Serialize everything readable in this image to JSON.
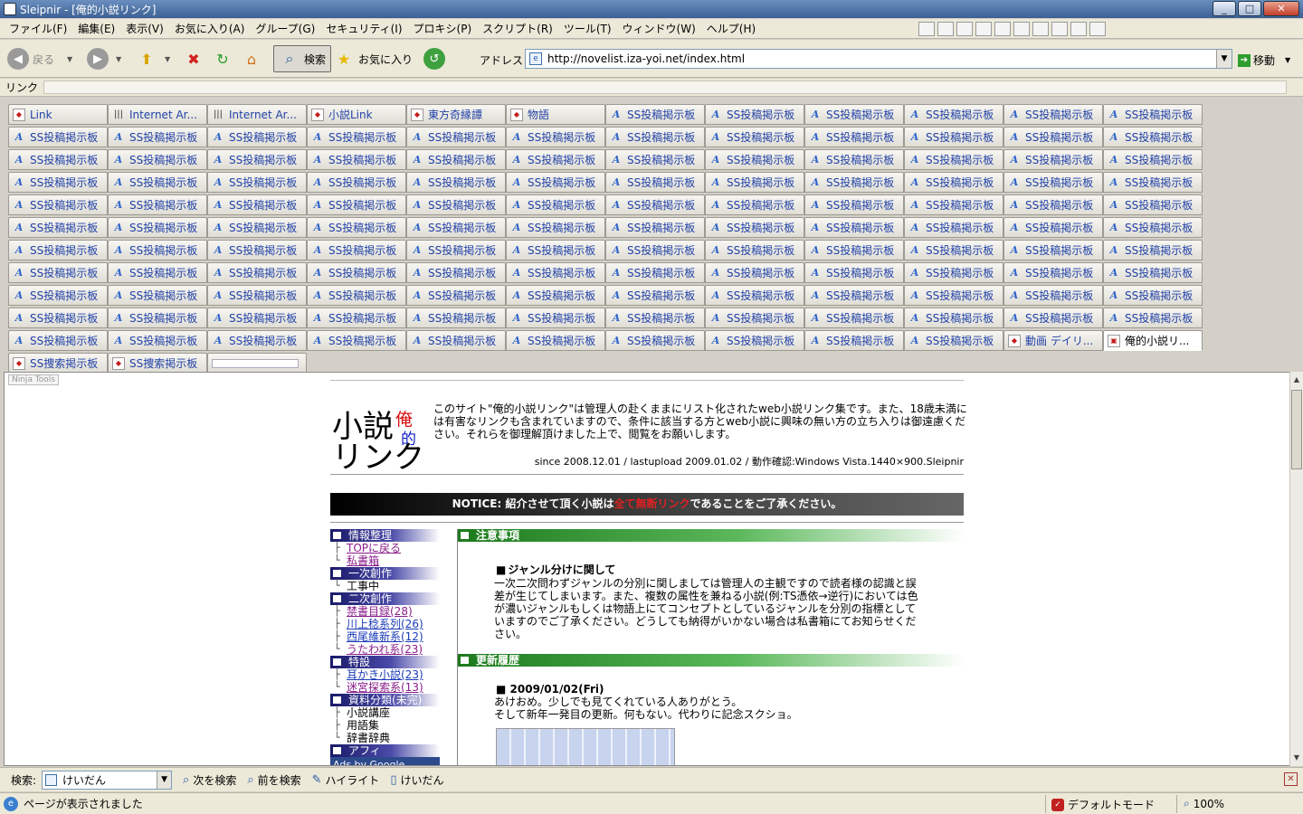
{
  "window": {
    "title": "Sleipnir - [俺的小説リンク]",
    "min": "_",
    "max": "□",
    "close": "✕"
  },
  "menu": [
    "ファイル(F)",
    "編集(E)",
    "表示(V)",
    "お気に入り(A)",
    "グループ(G)",
    "セキュリティ(I)",
    "プロキシ(P)",
    "スクリプト(R)",
    "ツール(T)",
    "ウィンドウ(W)",
    "ヘルプ(H)"
  ],
  "toolbar": {
    "back": "戻る",
    "search": "検索",
    "favorites": "お気に入り",
    "address_label": "アドレス",
    "go": "移動"
  },
  "address": {
    "url": "http://novelist.iza-yoi.net/index.html"
  },
  "links_bar": {
    "label": "リンク"
  },
  "tabs": [
    {
      "label": "Link",
      "icon": "r"
    },
    {
      "label": "Internet Ar...",
      "icon": "b"
    },
    {
      "label": "Internet Ar...",
      "icon": "b"
    },
    {
      "label": "小説Link",
      "icon": "r"
    },
    {
      "label": "東方奇縁譚",
      "icon": "r"
    },
    {
      "label": "物語",
      "icon": "r"
    },
    {
      "label": "SS投稿掲示板",
      "icon": "a"
    },
    {
      "label": "SS投稿掲示板",
      "icon": "a"
    },
    {
      "label": "SS投稿掲示板",
      "icon": "a"
    },
    {
      "label": "SS投稿掲示板",
      "icon": "a"
    },
    {
      "label": "SS投稿掲示板",
      "icon": "a"
    },
    {
      "label": "SS投稿掲示板",
      "icon": "a"
    }
  ],
  "tabs_repeat_label": "SS投稿掲示板",
  "tabs_tail": [
    {
      "label": "動画 デイリ...",
      "icon": "r"
    },
    {
      "label": "俺的小説リ...",
      "icon": "p",
      "active": true
    }
  ],
  "tabs_last_row": [
    {
      "label": "SS捜索掲示板",
      "icon": "r"
    },
    {
      "label": "SS捜索掲示板",
      "icon": "r"
    }
  ],
  "ninja": "Ninja Tools",
  "site": {
    "logo_a": "小説",
    "logo_b": "リンク",
    "logo_ore": "俺",
    "logo_teki": "的",
    "intro": "このサイト\"俺的小説リンク\"は管理人の赴くままにリスト化されたweb小説リンク集です。また、18歳未満には有害なリンクも含まれていますので、条件に該当する方とweb小説に興味の無い方の立ち入りは御遠慮ください。それらを御理解頂けました上で、閲覧をお願いします。",
    "since": "since 2008.12.01 / lastupload 2009.01.02 / 動作確認:Windows Vista.1440×900.Sleipnir",
    "notice_a": "NOTICE: 紹介させて頂く小説は",
    "notice_red": "全て無断リンク",
    "notice_b": "であることをご了承ください。"
  },
  "sidebar": [
    {
      "type": "h",
      "label": "情報整理"
    },
    {
      "type": "i",
      "label": "TOPに戻る",
      "link": "p"
    },
    {
      "type": "i",
      "label": "私書箱",
      "link": "p"
    },
    {
      "type": "h",
      "label": "一次創作"
    },
    {
      "type": "i",
      "label": "工事中",
      "link": ""
    },
    {
      "type": "h",
      "label": "二次創作"
    },
    {
      "type": "i",
      "label": "禁書目録(28)",
      "link": "p"
    },
    {
      "type": "i",
      "label": "川上稔系列(26)",
      "link": "b"
    },
    {
      "type": "i",
      "label": "西尾維新系(12)",
      "link": "b"
    },
    {
      "type": "i",
      "label": "うたわれ系(23)",
      "link": "p"
    },
    {
      "type": "h",
      "label": "特設"
    },
    {
      "type": "i",
      "label": "耳かき小説(23)",
      "link": "b"
    },
    {
      "type": "i",
      "label": "迷宮探索系(13)",
      "link": "p"
    },
    {
      "type": "h",
      "label": "資料分類(未完)"
    },
    {
      "type": "i",
      "label": "小説講座",
      "link": ""
    },
    {
      "type": "i",
      "label": "用語集",
      "link": ""
    },
    {
      "type": "i",
      "label": "辞書辞典",
      "link": ""
    },
    {
      "type": "h",
      "label": "アフィ"
    }
  ],
  "ads": "Ads by Google",
  "main": {
    "h1": "注意事項",
    "p_title": "ジャンル分けに関して",
    "p_text": "一次二次問わずジャンルの分別に関しましては管理人の主観ですので読者様の認識と誤差が生じてしまいます。また、複数の属性を兼ねる小説(例:TS憑依→逆行)においては色が濃いジャンルもしくは物語上にてコンセプトとしているジャンルを分別の指標としていますのでご了承ください。どうしても納得がいかない場合は私書箱にてお知らせください。",
    "h2": "更新履歴",
    "d_title": "2009/01/02(Fri)",
    "d_text1": "あけおめ。少しでも見てくれている人ありがとう。",
    "d_text2": "そして新年一発目の更新。何もない。代わりに記念スクショ。"
  },
  "findbar": {
    "label": "検索:",
    "value": "けいだん",
    "next": "次を検索",
    "prev": "前を検索",
    "highlight": "ハイライト",
    "word": "けいだん"
  },
  "status": {
    "text": "ページが表示されました",
    "mode": "デフォルトモード",
    "zoom": "100%"
  }
}
